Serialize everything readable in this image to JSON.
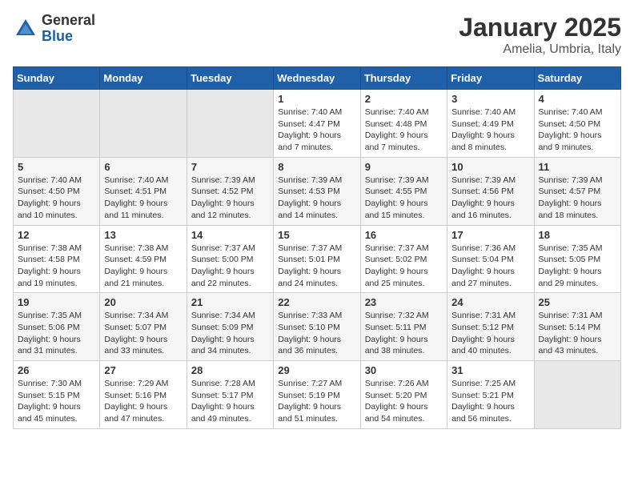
{
  "header": {
    "logo_general": "General",
    "logo_blue": "Blue",
    "month_title": "January 2025",
    "location": "Amelia, Umbria, Italy"
  },
  "weekdays": [
    "Sunday",
    "Monday",
    "Tuesday",
    "Wednesday",
    "Thursday",
    "Friday",
    "Saturday"
  ],
  "weeks": [
    [
      {
        "day": "",
        "sunrise": "",
        "sunset": "",
        "daylight": ""
      },
      {
        "day": "",
        "sunrise": "",
        "sunset": "",
        "daylight": ""
      },
      {
        "day": "",
        "sunrise": "",
        "sunset": "",
        "daylight": ""
      },
      {
        "day": "1",
        "sunrise": "Sunrise: 7:40 AM",
        "sunset": "Sunset: 4:47 PM",
        "daylight": "Daylight: 9 hours and 7 minutes."
      },
      {
        "day": "2",
        "sunrise": "Sunrise: 7:40 AM",
        "sunset": "Sunset: 4:48 PM",
        "daylight": "Daylight: 9 hours and 7 minutes."
      },
      {
        "day": "3",
        "sunrise": "Sunrise: 7:40 AM",
        "sunset": "Sunset: 4:49 PM",
        "daylight": "Daylight: 9 hours and 8 minutes."
      },
      {
        "day": "4",
        "sunrise": "Sunrise: 7:40 AM",
        "sunset": "Sunset: 4:50 PM",
        "daylight": "Daylight: 9 hours and 9 minutes."
      }
    ],
    [
      {
        "day": "5",
        "sunrise": "Sunrise: 7:40 AM",
        "sunset": "Sunset: 4:50 PM",
        "daylight": "Daylight: 9 hours and 10 minutes."
      },
      {
        "day": "6",
        "sunrise": "Sunrise: 7:40 AM",
        "sunset": "Sunset: 4:51 PM",
        "daylight": "Daylight: 9 hours and 11 minutes."
      },
      {
        "day": "7",
        "sunrise": "Sunrise: 7:39 AM",
        "sunset": "Sunset: 4:52 PM",
        "daylight": "Daylight: 9 hours and 12 minutes."
      },
      {
        "day": "8",
        "sunrise": "Sunrise: 7:39 AM",
        "sunset": "Sunset: 4:53 PM",
        "daylight": "Daylight: 9 hours and 14 minutes."
      },
      {
        "day": "9",
        "sunrise": "Sunrise: 7:39 AM",
        "sunset": "Sunset: 4:55 PM",
        "daylight": "Daylight: 9 hours and 15 minutes."
      },
      {
        "day": "10",
        "sunrise": "Sunrise: 7:39 AM",
        "sunset": "Sunset: 4:56 PM",
        "daylight": "Daylight: 9 hours and 16 minutes."
      },
      {
        "day": "11",
        "sunrise": "Sunrise: 7:39 AM",
        "sunset": "Sunset: 4:57 PM",
        "daylight": "Daylight: 9 hours and 18 minutes."
      }
    ],
    [
      {
        "day": "12",
        "sunrise": "Sunrise: 7:38 AM",
        "sunset": "Sunset: 4:58 PM",
        "daylight": "Daylight: 9 hours and 19 minutes."
      },
      {
        "day": "13",
        "sunrise": "Sunrise: 7:38 AM",
        "sunset": "Sunset: 4:59 PM",
        "daylight": "Daylight: 9 hours and 21 minutes."
      },
      {
        "day": "14",
        "sunrise": "Sunrise: 7:37 AM",
        "sunset": "Sunset: 5:00 PM",
        "daylight": "Daylight: 9 hours and 22 minutes."
      },
      {
        "day": "15",
        "sunrise": "Sunrise: 7:37 AM",
        "sunset": "Sunset: 5:01 PM",
        "daylight": "Daylight: 9 hours and 24 minutes."
      },
      {
        "day": "16",
        "sunrise": "Sunrise: 7:37 AM",
        "sunset": "Sunset: 5:02 PM",
        "daylight": "Daylight: 9 hours and 25 minutes."
      },
      {
        "day": "17",
        "sunrise": "Sunrise: 7:36 AM",
        "sunset": "Sunset: 5:04 PM",
        "daylight": "Daylight: 9 hours and 27 minutes."
      },
      {
        "day": "18",
        "sunrise": "Sunrise: 7:35 AM",
        "sunset": "Sunset: 5:05 PM",
        "daylight": "Daylight: 9 hours and 29 minutes."
      }
    ],
    [
      {
        "day": "19",
        "sunrise": "Sunrise: 7:35 AM",
        "sunset": "Sunset: 5:06 PM",
        "daylight": "Daylight: 9 hours and 31 minutes."
      },
      {
        "day": "20",
        "sunrise": "Sunrise: 7:34 AM",
        "sunset": "Sunset: 5:07 PM",
        "daylight": "Daylight: 9 hours and 33 minutes."
      },
      {
        "day": "21",
        "sunrise": "Sunrise: 7:34 AM",
        "sunset": "Sunset: 5:09 PM",
        "daylight": "Daylight: 9 hours and 34 minutes."
      },
      {
        "day": "22",
        "sunrise": "Sunrise: 7:33 AM",
        "sunset": "Sunset: 5:10 PM",
        "daylight": "Daylight: 9 hours and 36 minutes."
      },
      {
        "day": "23",
        "sunrise": "Sunrise: 7:32 AM",
        "sunset": "Sunset: 5:11 PM",
        "daylight": "Daylight: 9 hours and 38 minutes."
      },
      {
        "day": "24",
        "sunrise": "Sunrise: 7:31 AM",
        "sunset": "Sunset: 5:12 PM",
        "daylight": "Daylight: 9 hours and 40 minutes."
      },
      {
        "day": "25",
        "sunrise": "Sunrise: 7:31 AM",
        "sunset": "Sunset: 5:14 PM",
        "daylight": "Daylight: 9 hours and 43 minutes."
      }
    ],
    [
      {
        "day": "26",
        "sunrise": "Sunrise: 7:30 AM",
        "sunset": "Sunset: 5:15 PM",
        "daylight": "Daylight: 9 hours and 45 minutes."
      },
      {
        "day": "27",
        "sunrise": "Sunrise: 7:29 AM",
        "sunset": "Sunset: 5:16 PM",
        "daylight": "Daylight: 9 hours and 47 minutes."
      },
      {
        "day": "28",
        "sunrise": "Sunrise: 7:28 AM",
        "sunset": "Sunset: 5:17 PM",
        "daylight": "Daylight: 9 hours and 49 minutes."
      },
      {
        "day": "29",
        "sunrise": "Sunrise: 7:27 AM",
        "sunset": "Sunset: 5:19 PM",
        "daylight": "Daylight: 9 hours and 51 minutes."
      },
      {
        "day": "30",
        "sunrise": "Sunrise: 7:26 AM",
        "sunset": "Sunset: 5:20 PM",
        "daylight": "Daylight: 9 hours and 54 minutes."
      },
      {
        "day": "31",
        "sunrise": "Sunrise: 7:25 AM",
        "sunset": "Sunset: 5:21 PM",
        "daylight": "Daylight: 9 hours and 56 minutes."
      },
      {
        "day": "",
        "sunrise": "",
        "sunset": "",
        "daylight": ""
      }
    ]
  ]
}
